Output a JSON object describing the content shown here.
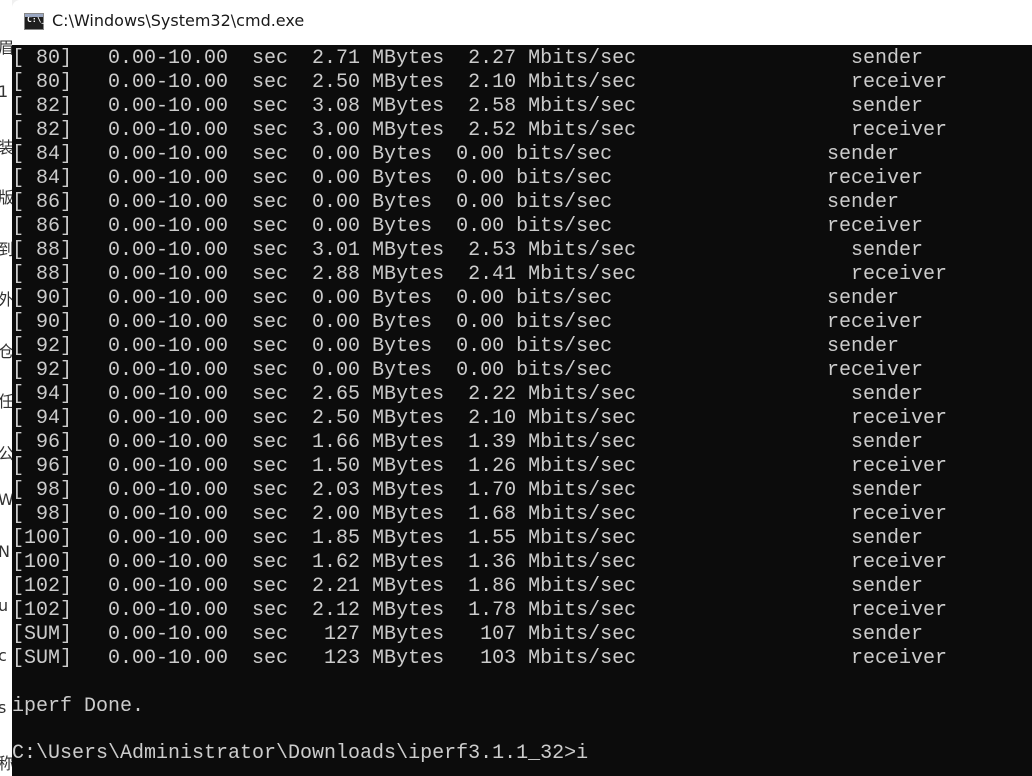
{
  "window": {
    "title": "C:\\Windows\\System32\\cmd.exe"
  },
  "background_fragments": [
    "眉",
    "1",
    "装",
    "版",
    "到",
    "外",
    "仓",
    "任",
    "公",
    "Wi",
    "N",
    "u",
    "c",
    "s",
    "称"
  ],
  "console": {
    "rows": [
      {
        "stats": "[ 80]   0.00-10.00  sec  2.71 MBytes  2.27 Mbits/sec",
        "role": "sender",
        "wide": true
      },
      {
        "stats": "[ 80]   0.00-10.00  sec  2.50 MBytes  2.10 Mbits/sec",
        "role": "receiver",
        "wide": true
      },
      {
        "stats": "[ 82]   0.00-10.00  sec  3.08 MBytes  2.58 Mbits/sec",
        "role": "sender",
        "wide": true
      },
      {
        "stats": "[ 82]   0.00-10.00  sec  3.00 MBytes  2.52 Mbits/sec",
        "role": "receiver",
        "wide": true
      },
      {
        "stats": "[ 84]   0.00-10.00  sec  0.00 Bytes  0.00 bits/sec",
        "role": "sender",
        "wide": false
      },
      {
        "stats": "[ 84]   0.00-10.00  sec  0.00 Bytes  0.00 bits/sec",
        "role": "receiver",
        "wide": false
      },
      {
        "stats": "[ 86]   0.00-10.00  sec  0.00 Bytes  0.00 bits/sec",
        "role": "sender",
        "wide": false
      },
      {
        "stats": "[ 86]   0.00-10.00  sec  0.00 Bytes  0.00 bits/sec",
        "role": "receiver",
        "wide": false
      },
      {
        "stats": "[ 88]   0.00-10.00  sec  3.01 MBytes  2.53 Mbits/sec",
        "role": "sender",
        "wide": true
      },
      {
        "stats": "[ 88]   0.00-10.00  sec  2.88 MBytes  2.41 Mbits/sec",
        "role": "receiver",
        "wide": true
      },
      {
        "stats": "[ 90]   0.00-10.00  sec  0.00 Bytes  0.00 bits/sec",
        "role": "sender",
        "wide": false
      },
      {
        "stats": "[ 90]   0.00-10.00  sec  0.00 Bytes  0.00 bits/sec",
        "role": "receiver",
        "wide": false
      },
      {
        "stats": "[ 92]   0.00-10.00  sec  0.00 Bytes  0.00 bits/sec",
        "role": "sender",
        "wide": false
      },
      {
        "stats": "[ 92]   0.00-10.00  sec  0.00 Bytes  0.00 bits/sec",
        "role": "receiver",
        "wide": false
      },
      {
        "stats": "[ 94]   0.00-10.00  sec  2.65 MBytes  2.22 Mbits/sec",
        "role": "sender",
        "wide": true
      },
      {
        "stats": "[ 94]   0.00-10.00  sec  2.50 MBytes  2.10 Mbits/sec",
        "role": "receiver",
        "wide": true
      },
      {
        "stats": "[ 96]   0.00-10.00  sec  1.66 MBytes  1.39 Mbits/sec",
        "role": "sender",
        "wide": true
      },
      {
        "stats": "[ 96]   0.00-10.00  sec  1.50 MBytes  1.26 Mbits/sec",
        "role": "receiver",
        "wide": true
      },
      {
        "stats": "[ 98]   0.00-10.00  sec  2.03 MBytes  1.70 Mbits/sec",
        "role": "sender",
        "wide": true
      },
      {
        "stats": "[ 98]   0.00-10.00  sec  2.00 MBytes  1.68 Mbits/sec",
        "role": "receiver",
        "wide": true
      },
      {
        "stats": "[100]   0.00-10.00  sec  1.85 MBytes  1.55 Mbits/sec",
        "role": "sender",
        "wide": true
      },
      {
        "stats": "[100]   0.00-10.00  sec  1.62 MBytes  1.36 Mbits/sec",
        "role": "receiver",
        "wide": true
      },
      {
        "stats": "[102]   0.00-10.00  sec  2.21 MBytes  1.86 Mbits/sec",
        "role": "sender",
        "wide": true
      },
      {
        "stats": "[102]   0.00-10.00  sec  2.12 MBytes  1.78 Mbits/sec",
        "role": "receiver",
        "wide": true
      },
      {
        "stats": "[SUM]   0.00-10.00  sec   127 MBytes   107 Mbits/sec",
        "role": "sender",
        "wide": true
      },
      {
        "stats": "[SUM]   0.00-10.00  sec   123 MBytes   103 Mbits/sec",
        "role": "receiver",
        "wide": true
      }
    ],
    "done_message": "iperf Done.",
    "prompt": "C:\\Users\\Administrator\\Downloads\\iperf3.1.1_32>i"
  }
}
